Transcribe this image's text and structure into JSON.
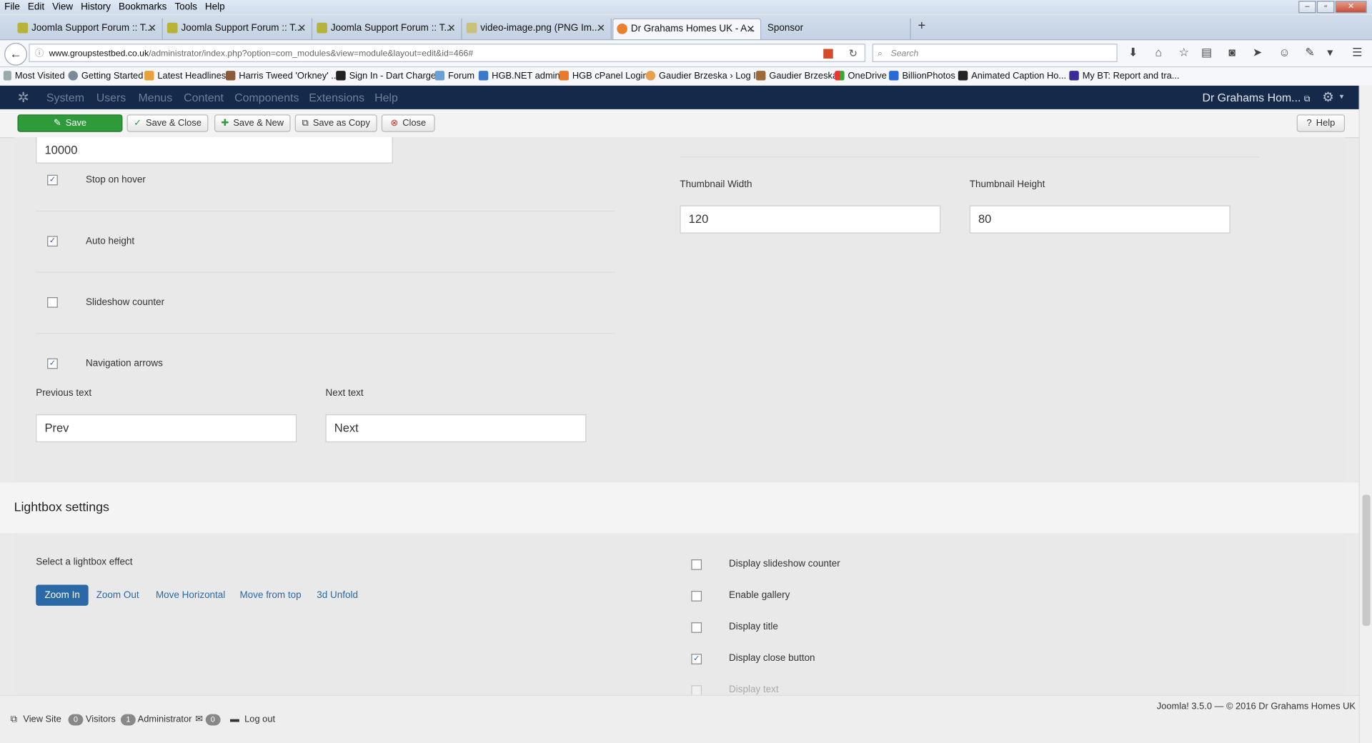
{
  "browser": {
    "menu": [
      "File",
      "Edit",
      "View",
      "History",
      "Bookmarks",
      "Tools",
      "Help"
    ],
    "tabs": [
      {
        "title": "Joomla Support Forum :: T..."
      },
      {
        "title": "Joomla Support Forum :: T..."
      },
      {
        "title": "Joomla Support Forum :: T..."
      },
      {
        "title": "video-image.png (PNG Im..."
      },
      {
        "title": "Dr Grahams Homes UK - A...",
        "active": true
      },
      {
        "title": "Sponsor"
      }
    ],
    "new_tab": "+",
    "url_domain": "www.groupstestbed.co.uk",
    "url_path": "/administrator/index.php?option=com_modules&view=module&layout=edit&id=466#",
    "search_placeholder": "Search",
    "bookmarks": [
      "Most Visited",
      "Getting Started",
      "Latest Headlines",
      "Harris Tweed 'Orkney' ...",
      "Sign In - Dart Charge",
      "Forum",
      "HGB.NET admin",
      "HGB cPanel Login",
      "Gaudier Brzeska › Log In",
      "Gaudier Brzeska",
      "OneDrive",
      "BillionPhotos",
      "Animated Caption Ho...",
      "My BT: Report and tra..."
    ]
  },
  "joomla": {
    "menu": [
      "System",
      "Users",
      "Menus",
      "Content",
      "Components",
      "Extensions",
      "Help"
    ],
    "site_title": "Dr Grahams Hom...",
    "toolbar": {
      "save": "Save",
      "save_close": "Save & Close",
      "save_new": "Save & New",
      "save_copy": "Save as Copy",
      "close": "Close",
      "help": "Help"
    }
  },
  "slideshow": {
    "interval_value": "10000",
    "options": [
      {
        "label": "Stop on hover",
        "checked": true
      },
      {
        "label": "Auto height",
        "checked": true
      },
      {
        "label": "Slideshow counter",
        "checked": false
      },
      {
        "label": "Navigation arrows",
        "checked": true
      }
    ],
    "prev_label": "Previous text",
    "prev_value": "Prev",
    "next_label": "Next text",
    "next_value": "Next",
    "thumb_width_label": "Thumbnail Width",
    "thumb_width_value": "120",
    "thumb_height_label": "Thumbnail Height",
    "thumb_height_value": "80"
  },
  "lightbox": {
    "heading": "Lightbox settings",
    "effect_label": "Select a lightbox effect",
    "effects": [
      "Zoom In",
      "Zoom Out",
      "Move Horizontal",
      "Move from top",
      "3d Unfold"
    ],
    "active_effect": "Zoom In",
    "options": [
      {
        "label": "Display slideshow counter",
        "checked": false
      },
      {
        "label": "Enable gallery",
        "checked": false
      },
      {
        "label": "Display title",
        "checked": false
      },
      {
        "label": "Display close button",
        "checked": true
      },
      {
        "label": "Display text",
        "checked": false
      }
    ]
  },
  "footer": {
    "view_site": "View Site",
    "visitors_count": "0",
    "visitors_label": "Visitors",
    "admin_count": "1",
    "admin_label": "Administrator",
    "messages_count": "0",
    "logout": "Log out",
    "copyright": "Joomla! 3.5.0  —  © 2016 Dr Grahams Homes UK"
  }
}
